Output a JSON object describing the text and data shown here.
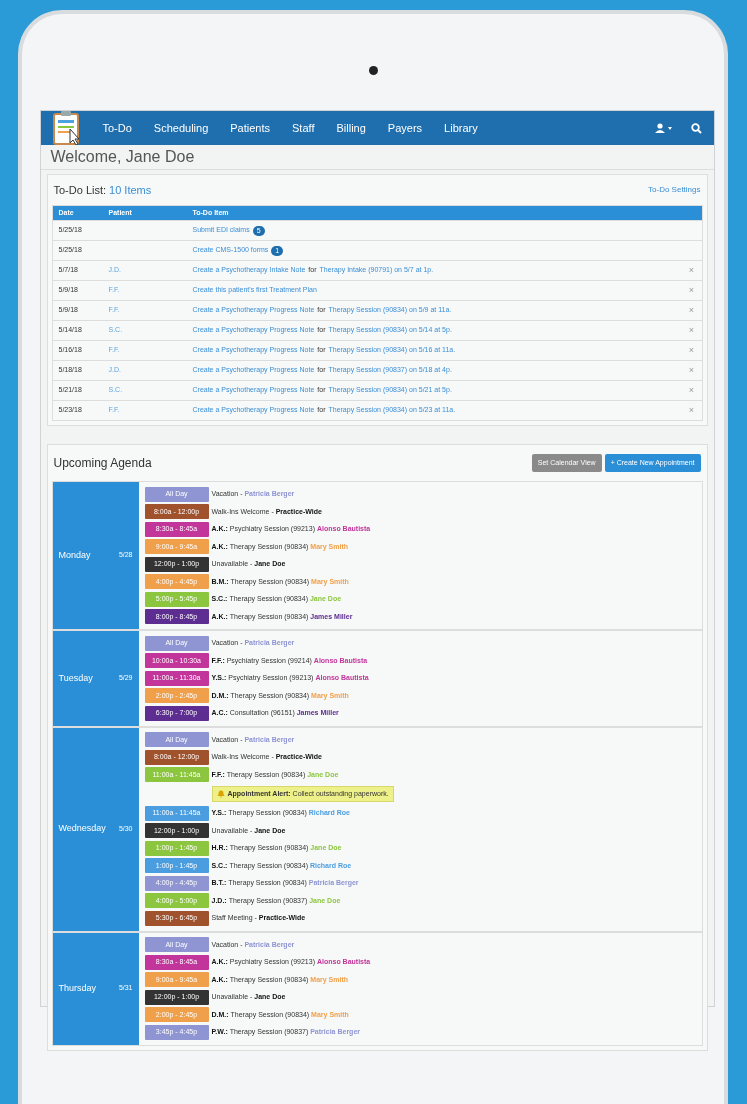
{
  "nav": {
    "items": [
      "To-Do",
      "Scheduling",
      "Patients",
      "Staff",
      "Billing",
      "Payers",
      "Library"
    ]
  },
  "welcome": "Welcome, Jane Doe",
  "todo": {
    "title": "To-Do List:",
    "count": "10 Items",
    "settings": "To-Do Settings",
    "columns": [
      "Date",
      "Patient",
      "To-Do Item"
    ],
    "rows": [
      {
        "date": "5/25/18",
        "parts": [
          {
            "kind": "link",
            "text": "Submit EDI claims"
          },
          {
            "kind": "badge",
            "text": "5"
          }
        ]
      },
      {
        "date": "5/25/18",
        "parts": [
          {
            "kind": "link",
            "text": "Create CMS-1500 forms"
          },
          {
            "kind": "badge",
            "text": "1"
          }
        ]
      },
      {
        "date": "5/7/18",
        "patient": "J.D.",
        "parts": [
          {
            "kind": "link",
            "text": "Create a Psychotherapy Intake Note"
          },
          {
            "kind": "plain",
            "text": "for"
          },
          {
            "kind": "link",
            "text": "Therapy Intake (90791) on 5/7 at 1p."
          }
        ],
        "dismiss": "×"
      },
      {
        "date": "5/9/18",
        "patient": "F.F.",
        "parts": [
          {
            "kind": "link",
            "text": "Create this patient's first Treatment Plan"
          }
        ],
        "dismiss": "×"
      },
      {
        "date": "5/9/18",
        "patient": "F.F.",
        "parts": [
          {
            "kind": "link",
            "text": "Create a Psychotherapy Progress Note"
          },
          {
            "kind": "plain",
            "text": "for"
          },
          {
            "kind": "link",
            "text": "Therapy Session (90834) on 5/9 at 11a."
          }
        ],
        "dismiss": "×"
      },
      {
        "date": "5/14/18",
        "patient": "S.C.",
        "parts": [
          {
            "kind": "link",
            "text": "Create a Psychotherapy Progress Note"
          },
          {
            "kind": "plain",
            "text": "for"
          },
          {
            "kind": "link",
            "text": "Therapy Session (90834) on 5/14 at 5p."
          }
        ],
        "dismiss": "×"
      },
      {
        "date": "5/16/18",
        "patient": "F.F.",
        "parts": [
          {
            "kind": "link",
            "text": "Create a Psychotherapy Progress Note"
          },
          {
            "kind": "plain",
            "text": "for"
          },
          {
            "kind": "link",
            "text": "Therapy Session (90834) on 5/16 at 11a."
          }
        ],
        "dismiss": "×"
      },
      {
        "date": "5/18/18",
        "patient": "J.D.",
        "parts": [
          {
            "kind": "link",
            "text": "Create a Psychotherapy Progress Note"
          },
          {
            "kind": "plain",
            "text": "for"
          },
          {
            "kind": "link",
            "text": "Therapy Session (90837) on 5/18 at 4p."
          }
        ],
        "dismiss": "×"
      },
      {
        "date": "5/21/18",
        "patient": "S.C.",
        "parts": [
          {
            "kind": "link",
            "text": "Create a Psychotherapy Progress Note"
          },
          {
            "kind": "plain",
            "text": "for"
          },
          {
            "kind": "link",
            "text": "Therapy Session (90834) on 5/21 at 5p."
          }
        ],
        "dismiss": "×"
      },
      {
        "date": "5/23/18",
        "patient": "F.F.",
        "parts": [
          {
            "kind": "link",
            "text": "Create a Psychotherapy Progress Note"
          },
          {
            "kind": "plain",
            "text": "for"
          },
          {
            "kind": "link",
            "text": "Therapy Session (90834) on 5/23 at 11a."
          }
        ],
        "dismiss": "×"
      }
    ]
  },
  "agenda": {
    "title": "Upcoming Agenda",
    "buttons": [
      "Set Calendar View",
      "+ Create New Appointment"
    ],
    "days": [
      {
        "name": "Monday",
        "date": "5/28",
        "events": [
          {
            "kind": "note",
            "time": "All Day",
            "color": "#8e95d2",
            "text": "Vacation -",
            "person": "Patricia Berger"
          },
          {
            "kind": "block",
            "time": "8:00a - 12:00p",
            "color": "#a0522d",
            "text": "Walk-Ins Welcome -",
            "person": "Practice-Wide"
          },
          {
            "kind": "appointment",
            "time": "8:30a - 8:45a",
            "color": "#c2359a",
            "lead": "A.K.:",
            "text": "Psychiatry Session (99213)",
            "person": "Alonso Bautista"
          },
          {
            "kind": "appointment",
            "time": "9:00a - 9:45a",
            "color": "#f0a04b",
            "lead": "A.K.:",
            "text": "Therapy Session (90834)",
            "person": "Mary Smith"
          },
          {
            "kind": "block",
            "time": "12:00p - 1:00p",
            "color": "#333333",
            "text": "Unavailable -",
            "person": "Jane Doe"
          },
          {
            "kind": "appointment",
            "time": "4:00p - 4:45p",
            "color": "#f0a04b",
            "lead": "B.M.:",
            "text": "Therapy Session (90834)",
            "person": "Mary Smith"
          },
          {
            "kind": "appointment",
            "time": "5:00p - 5:45p",
            "color": "#8cc63f",
            "lead": "S.C.:",
            "text": "Therapy Session (90834)",
            "person": "Jane Doe"
          },
          {
            "kind": "appointment",
            "time": "8:00p - 8:45p",
            "color": "#5e2d91",
            "lead": "A.K.:",
            "text": "Therapy Session (90834)",
            "person": "James Miller"
          }
        ]
      },
      {
        "name": "Tuesday",
        "date": "5/29",
        "events": [
          {
            "kind": "note",
            "time": "All Day",
            "color": "#8e95d2",
            "text": "Vacation -",
            "person": "Patricia Berger"
          },
          {
            "kind": "appointment",
            "time": "10:00a - 10:30a",
            "color": "#c2359a",
            "lead": "F.F.:",
            "text": "Psychiatry Session (99214)",
            "person": "Alonso Bautista"
          },
          {
            "kind": "appointment",
            "time": "11:00a - 11:30a",
            "color": "#c2359a",
            "lead": "Y.S.:",
            "text": "Psychiatry Session (99213)",
            "person": "Alonso Bautista"
          },
          {
            "kind": "appointment",
            "time": "2:00p - 2:45p",
            "color": "#f0a04b",
            "lead": "D.M.:",
            "text": "Therapy Session (90834)",
            "person": "Mary Smith"
          },
          {
            "kind": "appointment",
            "time": "6:30p - 7:00p",
            "color": "#5e2d91",
            "lead": "A.C.:",
            "text": "Consultation (96151)",
            "person": "James Miller"
          }
        ]
      },
      {
        "name": "Wednesday",
        "date": "5/30",
        "events": [
          {
            "kind": "note",
            "time": "All Day",
            "color": "#8e95d2",
            "text": "Vacation -",
            "person": "Patricia Berger"
          },
          {
            "kind": "block",
            "time": "8:00a - 12:00p",
            "color": "#a0522d",
            "text": "Walk-Ins Welcome -",
            "person": "Practice-Wide"
          },
          {
            "kind": "appointment",
            "time": "11:00a - 11:45a",
            "color": "#8cc63f",
            "lead": "F.F.:",
            "text": "Therapy Session (90834)",
            "person": "Jane Doe"
          },
          {
            "kind": "alert",
            "label": "Appointment Alert:",
            "text": "Collect outstanding paperwork."
          },
          {
            "kind": "appointment",
            "time": "11:00a - 11:45a",
            "color": "#4a9ee0",
            "lead": "Y.S.:",
            "text": "Therapy Session (90834)",
            "person": "Richard Roe"
          },
          {
            "kind": "block",
            "time": "12:00p - 1:00p",
            "color": "#333333",
            "text": "Unavailable -",
            "person": "Jane Doe"
          },
          {
            "kind": "appointment",
            "time": "1:00p - 1:45p",
            "color": "#8cc63f",
            "lead": "H.R.:",
            "text": "Therapy Session (90834)",
            "person": "Jane Doe"
          },
          {
            "kind": "appointment",
            "time": "1:00p - 1:45p",
            "color": "#4a9ee0",
            "lead": "S.C.:",
            "text": "Therapy Session (90834)",
            "person": "Richard Roe"
          },
          {
            "kind": "appointment",
            "time": "4:00p - 4:45p",
            "color": "#8e95d2",
            "lead": "B.T.:",
            "text": "Therapy Session (90834)",
            "person": "Patricia Berger"
          },
          {
            "kind": "appointment",
            "time": "4:00p - 5:00p",
            "color": "#8cc63f",
            "lead": "J.D.:",
            "text": "Therapy Session (90837)",
            "person": "Jane Doe"
          },
          {
            "kind": "block",
            "time": "5:30p - 6:45p",
            "color": "#a0522d",
            "text": "Staff Meeting -",
            "person": "Practice-Wide"
          }
        ]
      },
      {
        "name": "Thursday",
        "date": "5/31",
        "events": [
          {
            "kind": "note",
            "time": "All Day",
            "color": "#8e95d2",
            "text": "Vacation -",
            "person": "Patricia Berger"
          },
          {
            "kind": "appointment",
            "time": "8:30a - 8:45a",
            "color": "#c2359a",
            "lead": "A.K.:",
            "text": "Psychiatry Session (99213)",
            "person": "Alonso Bautista"
          },
          {
            "kind": "appointment",
            "time": "9:00a - 9:45a",
            "color": "#f0a04b",
            "lead": "A.K.:",
            "text": "Therapy Session (90834)",
            "person": "Mary Smith"
          },
          {
            "kind": "block",
            "time": "12:00p - 1:00p",
            "color": "#333333",
            "text": "Unavailable -",
            "person": "Jane Doe"
          },
          {
            "kind": "appointment",
            "time": "2:00p - 2:45p",
            "color": "#f0a04b",
            "lead": "D.M.:",
            "text": "Therapy Session (90834)",
            "person": "Mary Smith"
          },
          {
            "kind": "appointment",
            "time": "3:45p - 4:45p",
            "color": "#8e95d2",
            "lead": "P.W.:",
            "text": "Therapy Session (90837)",
            "person": "Patricia Berger"
          }
        ]
      }
    ]
  }
}
